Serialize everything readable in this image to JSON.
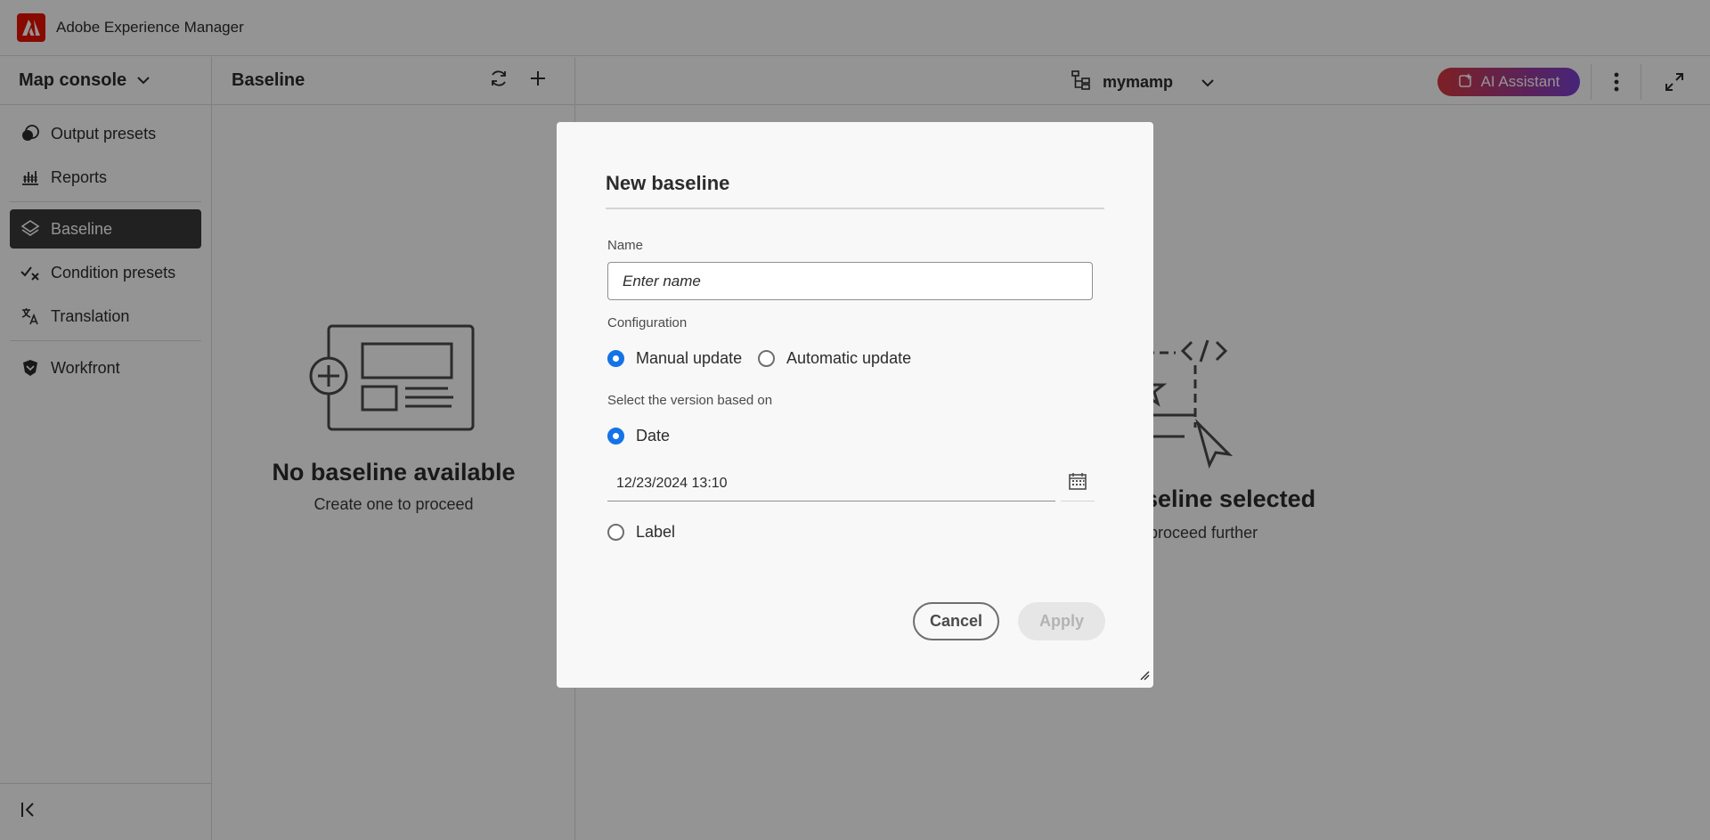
{
  "app": {
    "title": "Adobe Experience Manager"
  },
  "sidebar": {
    "title": "Map console",
    "items": [
      {
        "label": "Output presets",
        "icon": "output-presets-icon"
      },
      {
        "label": "Reports",
        "icon": "reports-icon"
      },
      {
        "label": "Baseline",
        "icon": "layers-icon",
        "active": true
      },
      {
        "label": "Condition presets",
        "icon": "condition-icon"
      },
      {
        "label": "Translation",
        "icon": "translate-icon"
      },
      {
        "label": "Workfront",
        "icon": "workfront-icon"
      }
    ]
  },
  "panel": {
    "title": "Baseline",
    "empty_title": "No baseline available",
    "empty_subtitle": "Create one to proceed"
  },
  "header": {
    "map_name": "mymamp",
    "ai_label": "AI Assistant"
  },
  "main": {
    "empty_title": "aseline selected",
    "empty_subtitle": "to proceed further"
  },
  "dialog": {
    "title": "New baseline",
    "name_label": "Name",
    "name_placeholder": "Enter name",
    "configuration_label": "Configuration",
    "config_options": [
      "Manual update",
      "Automatic update"
    ],
    "config_selected": "Manual update",
    "version_label": "Select the version based on",
    "version_options": [
      "Date",
      "Label"
    ],
    "version_selected": "Date",
    "date_value": "12/23/2024 13:10",
    "cancel_label": "Cancel",
    "apply_label": "Apply"
  },
  "colors": {
    "accent": "#1473e6",
    "brand": "#eb1000",
    "active_nav": "#3a3a3a"
  }
}
